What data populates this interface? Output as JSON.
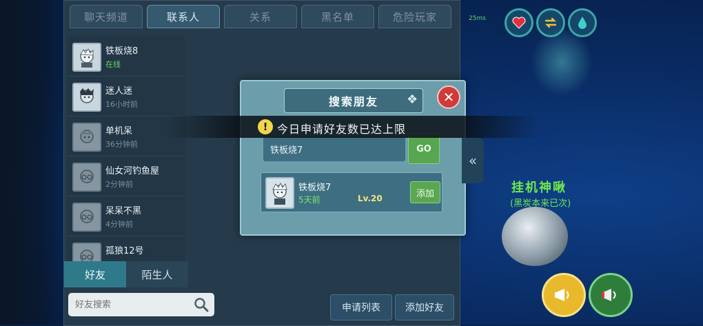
{
  "tabs": [
    "聊天频道",
    "联系人",
    "关系",
    "黑名单",
    "危险玩家"
  ],
  "active_tab": 1,
  "contacts": [
    {
      "name": "铁板烧8",
      "status": "在线",
      "online": true
    },
    {
      "name": "迷人迷",
      "status": "16小时前",
      "online": false
    },
    {
      "name": "单机呆",
      "status": "36分钟前",
      "online": false
    },
    {
      "name": "仙女河钓鱼屋",
      "status": "2分钟前",
      "online": false
    },
    {
      "name": "呆呆不黑",
      "status": "4分钟前",
      "online": false
    },
    {
      "name": "孤狼12号",
      "status": "",
      "online": false
    }
  ],
  "bottom_tabs": {
    "friends": "好友",
    "strangers": "陌生人"
  },
  "search": {
    "placeholder": "好友搜索"
  },
  "buttons": {
    "request_list": "申请列表",
    "add_friend": "添加好友"
  },
  "modal": {
    "title": "搜索朋友",
    "input_value": "铁板烧7",
    "go_label": "GO",
    "result": {
      "name": "铁板烧7",
      "time": "5天前",
      "level": "Lv.20",
      "add_label": "添加"
    }
  },
  "toast": {
    "text": "今日申请好友数已达上限"
  },
  "hud": {
    "signal": "25ms",
    "heart_icon": "heart-icon",
    "swap_icon": "swap-icon",
    "water_icon": "water-drop-icon"
  },
  "npc": {
    "name": "挂机神啾",
    "subtitle": "(黑炭本来已次)"
  },
  "colors": {
    "online": "#6ad46d",
    "npc_name": "#6ee84f",
    "close": "#d13a3a",
    "go": "#58a552"
  }
}
